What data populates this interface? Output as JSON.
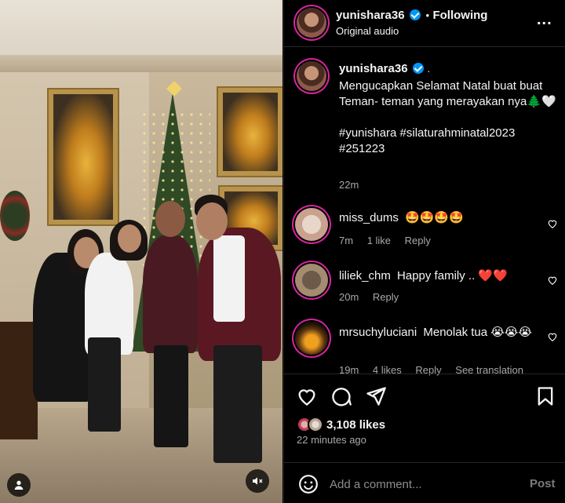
{
  "post": {
    "author": "yunishara36",
    "audio": "Original audio",
    "follow_status": "Following",
    "separator": "•",
    "more": "...",
    "caption_suffix": ".",
    "caption_line1": "Mengucapkan Selamat Natal buat buat Teman- teman yang merayakan nya",
    "caption_emoji": "🌲🤍",
    "hashtags": "#yunishara #silaturahminatal2023 #251223",
    "caption_time": "22m"
  },
  "comments": [
    {
      "user": "miss_dums",
      "text": "🤩🤩🤩🤩",
      "time": "7m",
      "likes": "1 like",
      "reply": "Reply",
      "translate": ""
    },
    {
      "user": "liliek_chm",
      "text": "Happy family .. ❤️❤️",
      "time": "20m",
      "likes": "",
      "reply": "Reply",
      "translate": ""
    },
    {
      "user": "mrsuchyluciani",
      "text": "Menolak tua 😭😭😭",
      "time": "19m",
      "likes": "4 likes",
      "reply": "Reply",
      "translate": "See translation"
    }
  ],
  "engagement": {
    "likes": "3,108 likes",
    "time_ago": "22 minutes ago"
  },
  "composer": {
    "placeholder": "Add a comment...",
    "post_label": "Post"
  },
  "colors": {
    "background": "#000000",
    "verified": "#0095f6",
    "story_ring": "#d6249f",
    "muted_text": "#a8a8a8"
  },
  "icons": [
    "verified-badge-icon",
    "more-icon",
    "heart-icon",
    "comment-icon",
    "share-icon",
    "bookmark-icon",
    "emoji-icon",
    "tag-people-icon",
    "mute-icon"
  ]
}
